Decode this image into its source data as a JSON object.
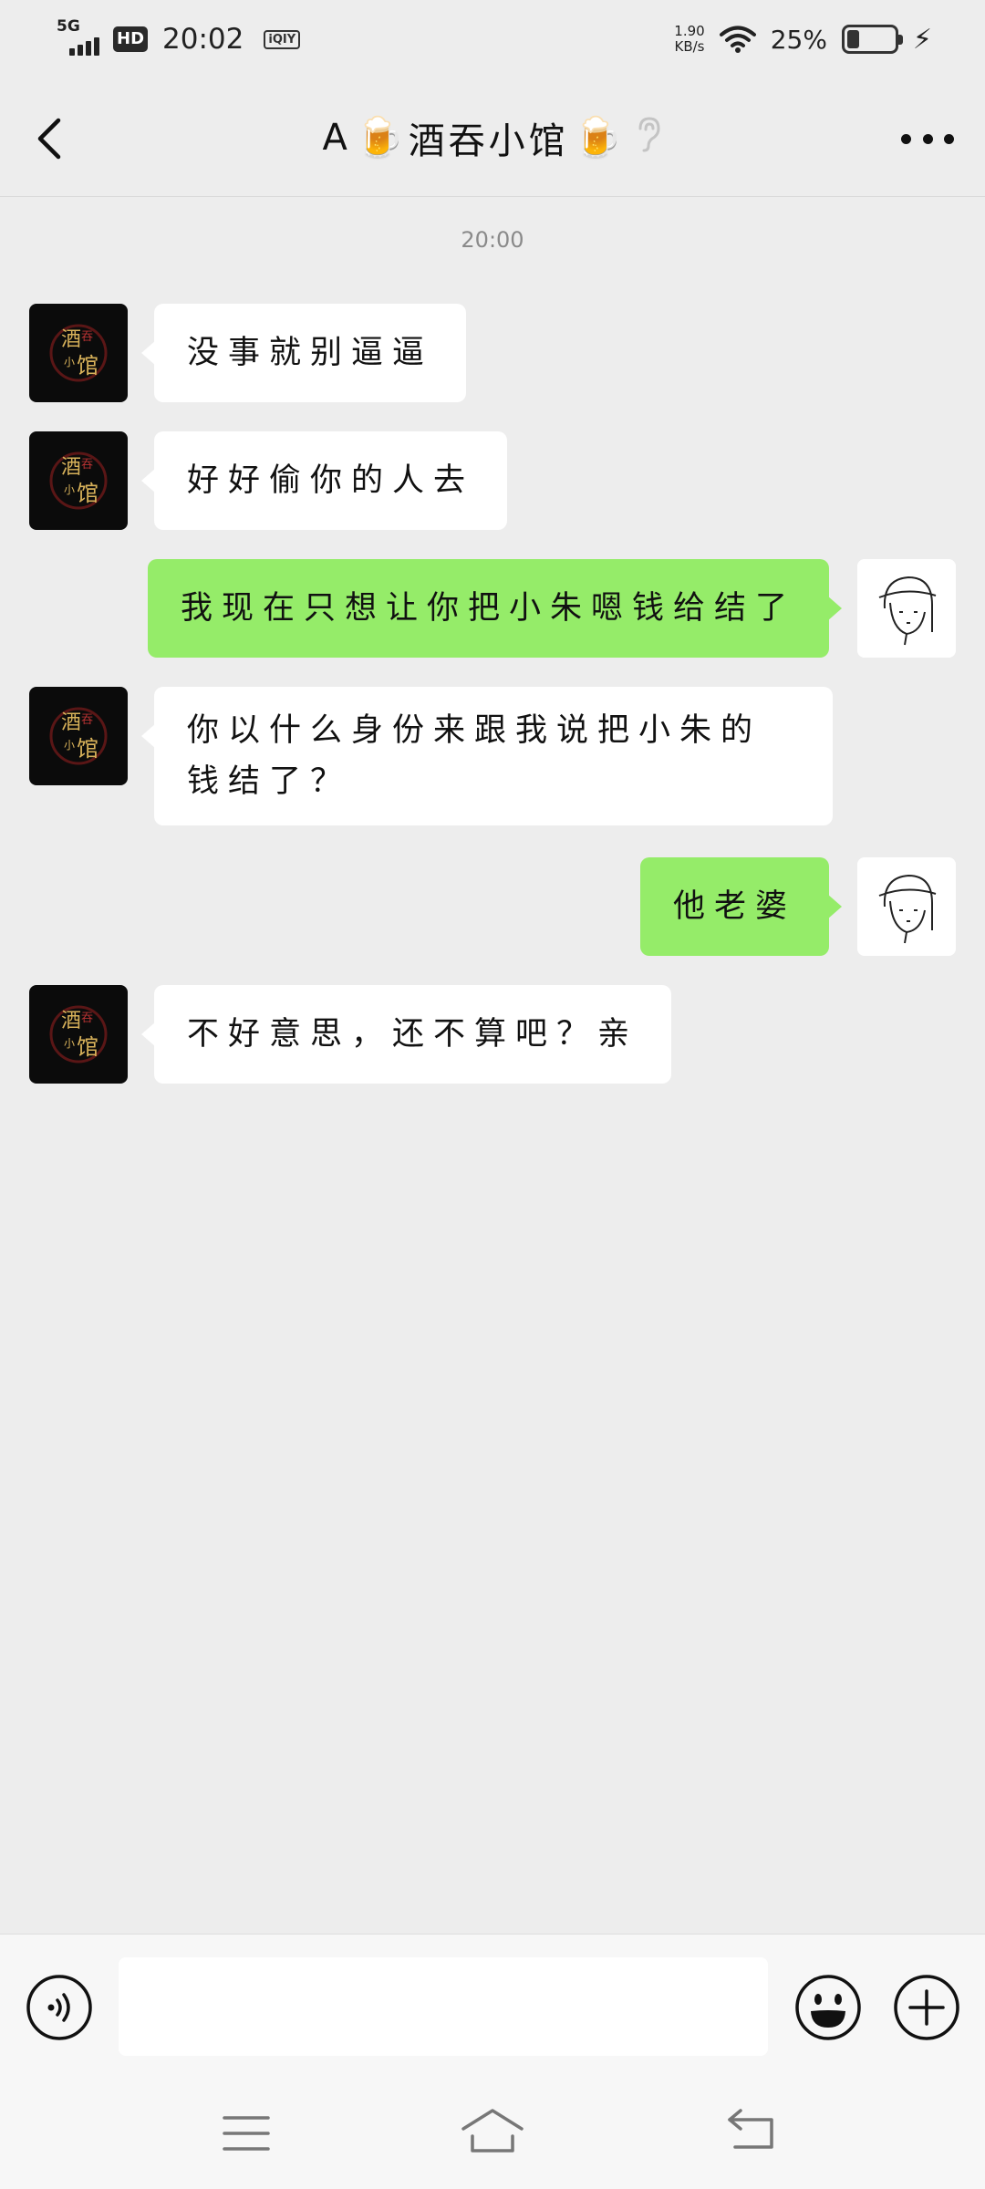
{
  "status_bar": {
    "network": "5G",
    "hd_badge": "HD",
    "time": "20:02",
    "app_indicator": "iQIY",
    "net_speed_value": "1.90",
    "net_speed_unit": "KB/s",
    "battery_percent": "25%",
    "battery_level": 0.25,
    "icons": [
      "signal-icon",
      "wifi-icon",
      "battery-icon",
      "charging-icon"
    ]
  },
  "header": {
    "title_prefix": "A",
    "title_name": "酒吞小馆",
    "title_emoji": "🍺",
    "icons": [
      "back-icon",
      "beer-icon",
      "ear-icon",
      "more-icon"
    ]
  },
  "chat": {
    "timestamp": "20:00",
    "messages": [
      {
        "side": "in",
        "text": "没事就别逼逼"
      },
      {
        "side": "in",
        "text": "好好偷你的人去"
      },
      {
        "side": "out",
        "text": "我现在只想让你把小朱嗯钱给结了"
      },
      {
        "side": "in",
        "text": "你以什么身份来跟我说把小朱的钱结了？"
      },
      {
        "side": "out",
        "text": "他老婆"
      },
      {
        "side": "in",
        "text": "不好意思，还不算吧？亲"
      }
    ],
    "contact_avatar_text": "酒吞小馆"
  },
  "input_bar": {
    "value": "",
    "icons": [
      "voice-icon",
      "emoji-icon",
      "plus-icon"
    ]
  },
  "nav_bar": {
    "icons": [
      "menu-icon",
      "home-icon",
      "return-icon"
    ]
  },
  "colors": {
    "background": "#ededed",
    "outgoing_bubble": "#95ec69",
    "incoming_bubble": "#ffffff",
    "avatar_bg": "#0b0b0b",
    "avatar_accent": "#d8b25a"
  }
}
